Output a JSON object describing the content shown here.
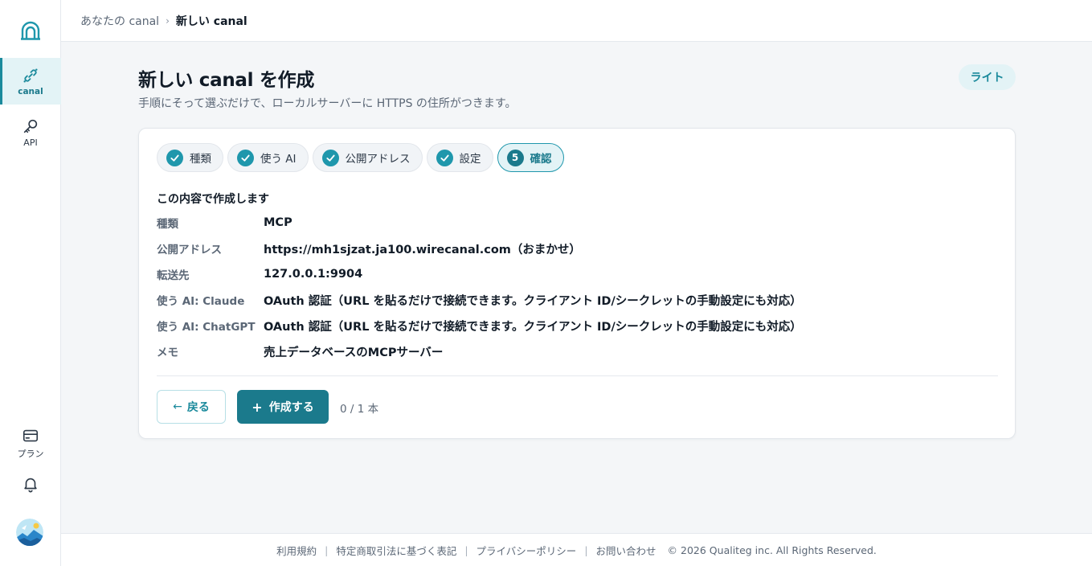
{
  "sidebar": {
    "items": [
      {
        "label": "canal",
        "icon": "link-icon",
        "active": true
      },
      {
        "label": "API",
        "icon": "key-icon",
        "active": false
      },
      {
        "label": "プラン",
        "icon": "credit-card-icon",
        "active": false
      }
    ]
  },
  "breadcrumb": {
    "parent": "あなたの canal",
    "separator": "›",
    "current": "新しい canal"
  },
  "page": {
    "title": "新しい canal を作成",
    "subtitle": "手順にそって選ぶだけで、ローカルサーバーに HTTPS の住所がつきます。",
    "theme_toggle": "ライト"
  },
  "steps": [
    {
      "label": "種類",
      "state": "done"
    },
    {
      "label": "使う AI",
      "state": "done"
    },
    {
      "label": "公開アドレス",
      "state": "done"
    },
    {
      "label": "設定",
      "state": "done"
    },
    {
      "label": "確認",
      "number": "5",
      "state": "current"
    }
  ],
  "summary": {
    "heading": "この内容で作成します",
    "rows": [
      {
        "key": "種類",
        "value": "MCP"
      },
      {
        "key": "公開アドレス",
        "value": "https://mh1sjzat.ja100.wirecanal.com（おまかせ）"
      },
      {
        "key": "転送先",
        "value": "127.0.0.1:9904"
      },
      {
        "key": "使う AI: Claude",
        "value": "OAuth 認証（URL を貼るだけで接続できます。クライアント ID/シークレットの手動設定にも対応）"
      },
      {
        "key": "使う AI: ChatGPT",
        "value": "OAuth 認証（URL を貼るだけで接続できます。クライアント ID/シークレットの手動設定にも対応）"
      },
      {
        "key": "メモ",
        "value": "売上データベースのMCPサーバー"
      }
    ]
  },
  "actions": {
    "back_arrow": "←",
    "back_label": "戻る",
    "create_plus": "+",
    "create_label": "作成する",
    "count": "0 / 1 本"
  },
  "footer": {
    "links": [
      "利用規約",
      "特定商取引法に基づく表記",
      "プライバシーポリシー",
      "お問い合わせ"
    ],
    "separator": "|",
    "copyright": "© 2026 Qualiteg inc. All Rights Reserved."
  },
  "colors": {
    "accent": "#1b7a8c",
    "accent_light": "#1f97ac",
    "accent_bg": "#e3f3f6",
    "page_bg": "#f4f6f8"
  }
}
